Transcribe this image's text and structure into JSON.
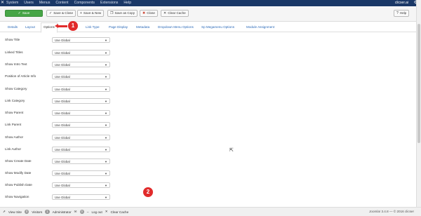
{
  "topbar": {
    "menu": [
      "System",
      "Users",
      "Menus",
      "Content",
      "Components",
      "Extensions",
      "Help"
    ],
    "user": "clicser.ai",
    "logo_icon": "joomla-icon",
    "settings_icon": "gear-icon"
  },
  "toolbar": {
    "save": "Save",
    "save_close": "Save & Close",
    "save_new": "Save & New",
    "save_copy": "Save as Copy",
    "close": "Close",
    "clear_cache": "Clear Cache",
    "help": "Help"
  },
  "tabs": [
    "Details",
    "Layout",
    "Options",
    "Link Type",
    "Page Display",
    "Metadata",
    "Dropdown Menu Options",
    "Sp Megamenu Options",
    "Module Assignment"
  ],
  "active_tab": "Options",
  "fields": [
    {
      "label": "Show Title",
      "value": "Use Global"
    },
    {
      "label": "Linked Titles",
      "value": "Use Global"
    },
    {
      "label": "Show Intro Text",
      "value": "Use Global"
    },
    {
      "label": "Position of Article Info",
      "value": "Use Global"
    },
    {
      "label": "Show Category",
      "value": "Use Global"
    },
    {
      "label": "Link Category",
      "value": "Use Global"
    },
    {
      "label": "Show Parent",
      "value": "Use Global"
    },
    {
      "label": "Link Parent",
      "value": "Use Global"
    },
    {
      "label": "Show Author",
      "value": "Use Global"
    },
    {
      "label": "Link Author",
      "value": "Use Global"
    },
    {
      "label": "Show Create Date",
      "value": "Use Global"
    },
    {
      "label": "Show Modify Date",
      "value": "Use Global"
    },
    {
      "label": "Show Publish Date",
      "value": "Use Global"
    },
    {
      "label": "Show Navigation",
      "value": "Use Global"
    }
  ],
  "annotations": {
    "badge1": "1",
    "badge2": "2"
  },
  "footer": {
    "view_site": "View Site",
    "visitors_count": "0",
    "visitors": "Visitors",
    "admin_count": "1",
    "admin": "Administrator",
    "mail_count": "0",
    "logout": "Log out",
    "clear_cache": "Clear Cache",
    "version": "Joomla! 3.4.8 — © 2016 clicser"
  },
  "colors": {
    "topbar": "#1a3867",
    "save": "#46a546",
    "annotation": "#e12b2b",
    "link": "#2a69b8"
  }
}
